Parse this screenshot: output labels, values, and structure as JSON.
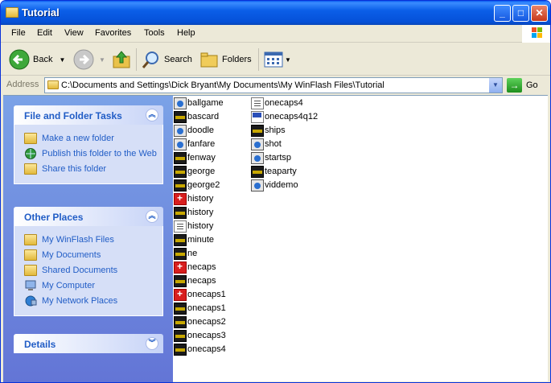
{
  "window": {
    "title": "Tutorial"
  },
  "menubar": {
    "items": [
      "File",
      "Edit",
      "View",
      "Favorites",
      "Tools",
      "Help"
    ]
  },
  "toolbar": {
    "back": "Back",
    "search": "Search",
    "folders": "Folders"
  },
  "address": {
    "label": "Address",
    "path": "C:\\Documents and Settings\\Dick Bryant\\My Documents\\My WinFlash Files\\Tutorial",
    "go": "Go"
  },
  "tasks": {
    "file_folder": {
      "title": "File and Folder Tasks",
      "items": [
        "Make a new folder",
        "Publish this folder to the Web",
        "Share this folder"
      ]
    },
    "other_places": {
      "title": "Other Places",
      "items": [
        "My WinFlash Files",
        "My Documents",
        "Shared Documents",
        "My Computer",
        "My Network Places"
      ]
    },
    "details": {
      "title": "Details"
    }
  },
  "files": [
    {
      "name": "ballgame",
      "icon": "flv-icon"
    },
    {
      "name": "bascard",
      "icon": "movie-icon"
    },
    {
      "name": "doodle",
      "icon": "flv-icon"
    },
    {
      "name": "fanfare",
      "icon": "flv-icon"
    },
    {
      "name": "fenway",
      "icon": "movie-icon"
    },
    {
      "name": "george",
      "icon": "movie-icon"
    },
    {
      "name": "george2",
      "icon": "movie-icon"
    },
    {
      "name": "history",
      "icon": "red-icon"
    },
    {
      "name": "history",
      "icon": "movie-icon"
    },
    {
      "name": "history",
      "icon": "doc-icon"
    },
    {
      "name": "minute",
      "icon": "movie-icon"
    },
    {
      "name": "ne",
      "icon": "movie-icon"
    },
    {
      "name": "necaps",
      "icon": "red-icon"
    },
    {
      "name": "necaps",
      "icon": "movie-icon"
    },
    {
      "name": "onecaps1",
      "icon": "red-icon"
    },
    {
      "name": "onecaps1",
      "icon": "movie-icon"
    },
    {
      "name": "onecaps2",
      "icon": "movie-icon"
    },
    {
      "name": "onecaps3",
      "icon": "movie-icon"
    },
    {
      "name": "onecaps4",
      "icon": "movie-icon"
    },
    {
      "name": "onecaps4",
      "icon": "doc-icon"
    },
    {
      "name": "onecaps4q12",
      "icon": "ms-icon"
    },
    {
      "name": "ships",
      "icon": "movie-icon"
    },
    {
      "name": "shot",
      "icon": "flv-icon"
    },
    {
      "name": "startsp",
      "icon": "flv-icon"
    },
    {
      "name": "teaparty",
      "icon": "movie-icon"
    },
    {
      "name": "viddemo",
      "icon": "flv-icon"
    }
  ]
}
